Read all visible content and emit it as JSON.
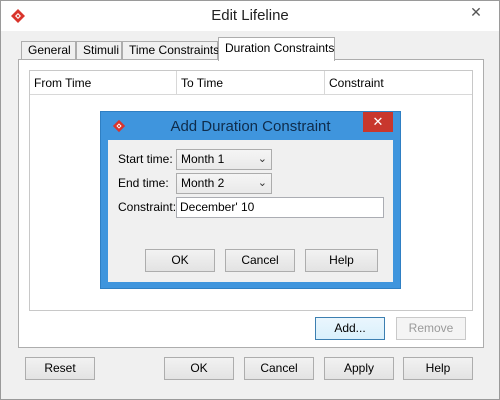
{
  "window": {
    "title": "Edit Lifeline",
    "close_glyph": "✕"
  },
  "tabs": [
    {
      "label": "General"
    },
    {
      "label": "Stimuli"
    },
    {
      "label": "Time Constraints"
    },
    {
      "label": "Duration Constraints"
    }
  ],
  "table": {
    "columns": [
      "From Time",
      "To Time",
      "Constraint"
    ]
  },
  "panel_buttons": {
    "add": "Add...",
    "remove": "Remove"
  },
  "footer_buttons": {
    "reset": "Reset",
    "ok": "OK",
    "cancel": "Cancel",
    "apply": "Apply",
    "help": "Help"
  },
  "dialog": {
    "title": "Add Duration Constraint",
    "close_glyph": "✕",
    "start_label": "Start time:",
    "start_value": "Month 1",
    "end_label": "End time:",
    "end_value": "Month 2",
    "constraint_label": "Constraint:",
    "constraint_value": "December' 10",
    "ok": "OK",
    "cancel": "Cancel",
    "help": "Help"
  },
  "colors": {
    "dialog_frame": "#3f95dd",
    "close_red": "#c8372d",
    "app_icon_red": "#d9342b"
  },
  "icons": {
    "app": "app-logo-icon",
    "dropdown": "chevron-down-icon",
    "close": "close-icon"
  }
}
